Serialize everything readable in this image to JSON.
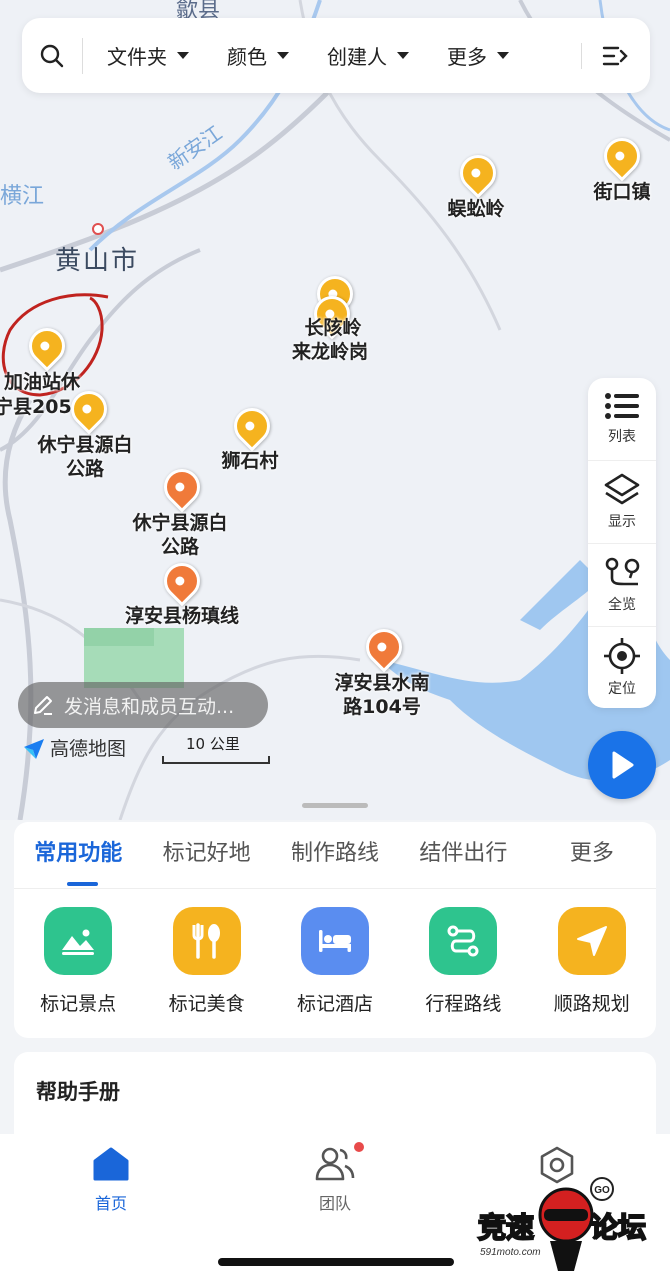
{
  "map": {
    "city": "黄山市",
    "river": "新安江",
    "county_top": "歙县",
    "edge_left": "横江",
    "places": [
      {
        "label": "蜈蚣岭",
        "color": "yellow"
      },
      {
        "label": "街口镇",
        "color": "yellow"
      },
      {
        "label": "长陔岭",
        "color": "yellow"
      },
      {
        "label": "来龙岭岗",
        "color": "yellow"
      },
      {
        "label": "加油站休",
        "color": "yellow"
      },
      {
        "label": "宁县205",
        "color": "yellow"
      },
      {
        "label": "休宁县源白公路",
        "color": "yellow"
      },
      {
        "label": "狮石村",
        "color": "yellow"
      },
      {
        "label": "休宁县源白公路",
        "color": "orange"
      },
      {
        "label": "淳安县杨瑱线",
        "color": "orange"
      },
      {
        "label": "淳安县水南路104号",
        "color": "orange"
      }
    ],
    "brand": "高德地图",
    "scale": "10 公里"
  },
  "topbar": {
    "filters": [
      "文件夹",
      "颜色",
      "创建人",
      "更多"
    ]
  },
  "tools": [
    "列表",
    "显示",
    "全览",
    "定位"
  ],
  "message_placeholder": "发消息和成员互动...",
  "tabs": [
    "常用功能",
    "标记好地",
    "制作路线",
    "结伴出行",
    "更多"
  ],
  "functions": [
    {
      "label": "标记景点",
      "color": "#2ec48e"
    },
    {
      "label": "标记美食",
      "color": "#f5b31f"
    },
    {
      "label": "标记酒店",
      "color": "#5a8df0"
    },
    {
      "label": "行程路线",
      "color": "#2ec48e"
    },
    {
      "label": "顺路规划",
      "color": "#f5b31f"
    }
  ],
  "help_title": "帮助手册",
  "nav": [
    "首页",
    "团队",
    ""
  ],
  "watermark": {
    "brand": "竞速论坛",
    "site": "591moto.com",
    "badge": "GO"
  },
  "colors": {
    "accent": "#1a66d9",
    "pin_yellow": "#f5b31f",
    "pin_orange": "#f07a3a"
  }
}
